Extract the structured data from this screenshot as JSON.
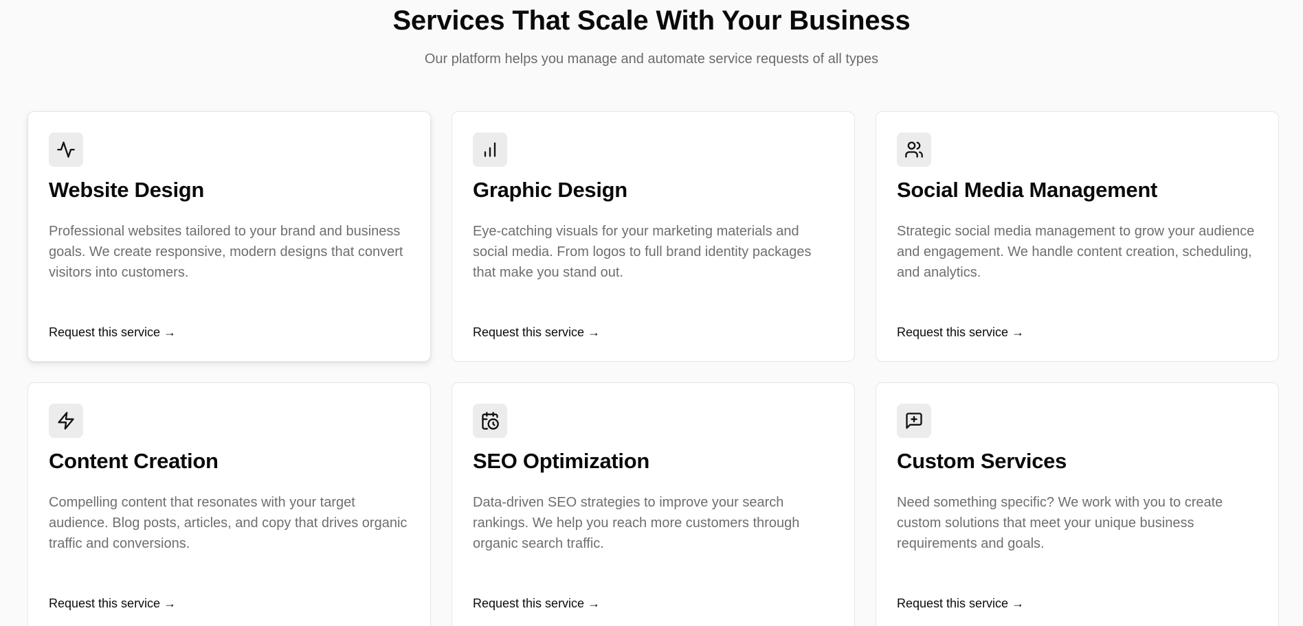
{
  "header": {
    "title": "Services That Scale With Your Business",
    "subtitle": "Our platform helps you manage and automate service requests of all types"
  },
  "services": [
    {
      "icon": "activity-icon",
      "title": "Website Design",
      "description": "Professional websites tailored to your brand and business goals. We create responsive, modern designs that convert visitors into customers.",
      "link": "Request this service →"
    },
    {
      "icon": "bar-chart-icon",
      "title": "Graphic Design",
      "description": "Eye-catching visuals for your marketing materials and social media. From logos to full brand identity packages that make you stand out.",
      "link": "Request this service →"
    },
    {
      "icon": "users-icon",
      "title": "Social Media Management",
      "description": "Strategic social media management to grow your audience and engagement. We handle content creation, scheduling, and analytics.",
      "link": "Request this service →"
    },
    {
      "icon": "lightning-icon",
      "title": "Content Creation",
      "description": "Compelling content that resonates with your target audience. Blog posts, articles, and copy that drives organic traffic and conversions.",
      "link": "Request this service →"
    },
    {
      "icon": "calendar-clock-icon",
      "title": "SEO Optimization",
      "description": "Data-driven SEO strategies to improve your search rankings. We help you reach more customers through organic search traffic.",
      "link": "Request this service →"
    },
    {
      "icon": "message-plus-icon",
      "title": "Custom Services",
      "description": "Need something specific? We work with you to create custom solutions that meet your unique business requirements and goals.",
      "link": "Request this service →"
    }
  ]
}
